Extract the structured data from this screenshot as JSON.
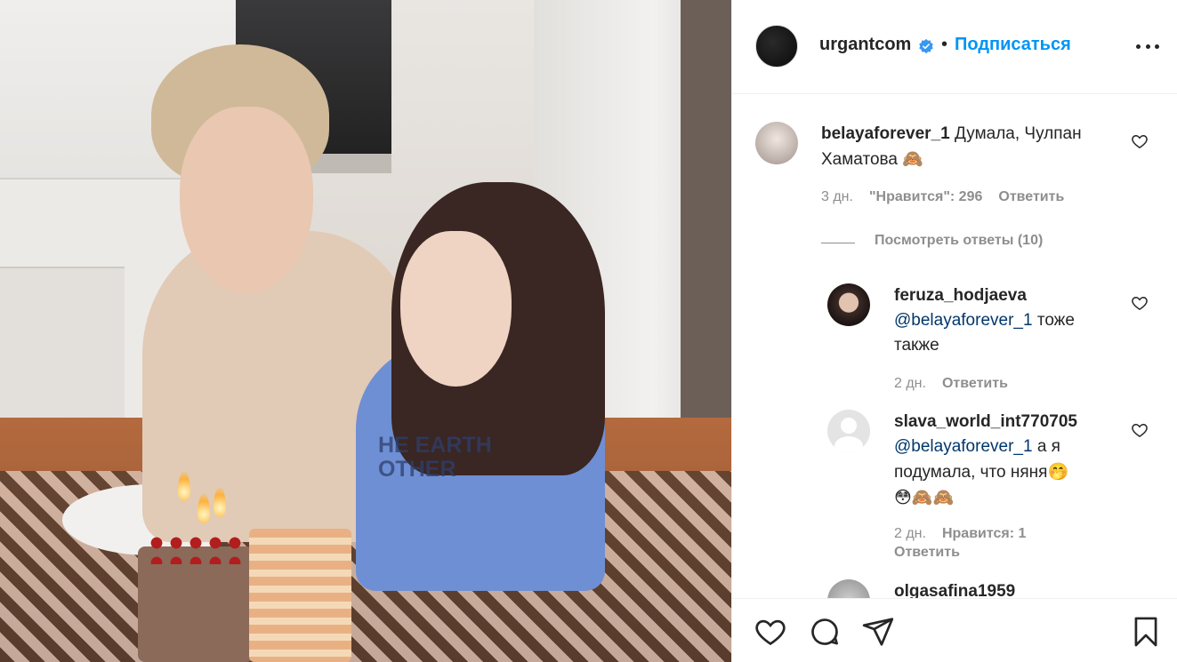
{
  "post": {
    "photo_alt": "",
    "photo_shirt_text": "HE EARTH OTHER"
  },
  "header": {
    "username": "urgantcom",
    "separator": "•",
    "follow_label": "Подписаться"
  },
  "comments": [
    {
      "username": "belayaforever_1",
      "text": "Думала, Чулпан Хаматова",
      "emoji": "🙈",
      "time": "3 дн.",
      "likes_label": "\"Нравится\": 296",
      "reply_label": "Ответить",
      "view_replies_label": "Посмотреть ответы (10)"
    },
    {
      "username": "feruza_hodjaeva",
      "mention": "@belayaforever_1",
      "text": " тоже также",
      "time": "2 дн.",
      "reply_label": "Ответить"
    },
    {
      "username": "slava_world_int770705",
      "mention": "@belayaforever_1",
      "text": " а я подумала, что няня",
      "emoji_inline": "🤭",
      "emoji_line": "😳🙈🙈",
      "time": "2 дн.",
      "likes_label": "Нравится: 1",
      "reply_label": "Ответить"
    },
    {
      "username": "olgasafina1959"
    }
  ],
  "colors": {
    "accent": "#0095f6",
    "text": "#262626",
    "muted": "#8e8e8e",
    "mention": "#00376b"
  },
  "icons": [
    "verified-badge-icon",
    "more-options-icon",
    "heart-icon",
    "comment-icon",
    "share-icon",
    "bookmark-icon"
  ]
}
